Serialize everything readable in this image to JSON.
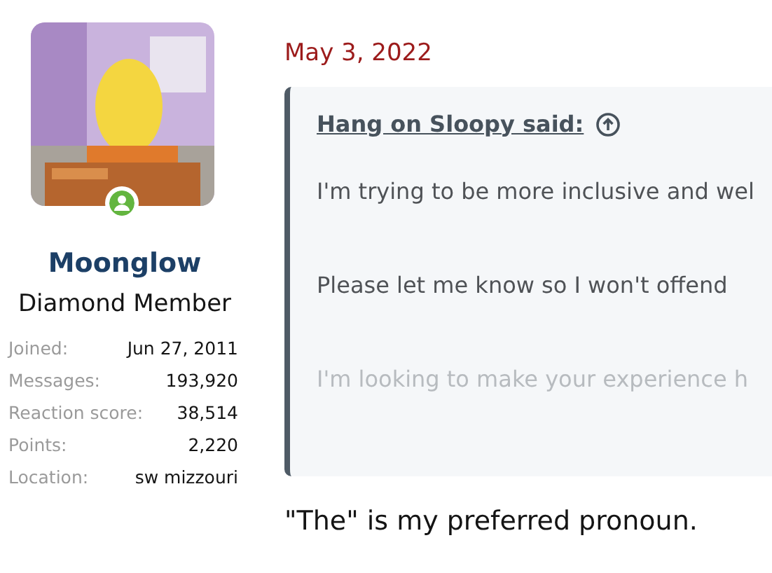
{
  "user": {
    "online": true,
    "name": "Moonglow",
    "title": "Diamond Member",
    "stats": [
      {
        "label": "Joined:",
        "value": "Jun 27, 2011"
      },
      {
        "label": "Messages:",
        "value": "193,920"
      },
      {
        "label": "Reaction score:",
        "value": "38,514"
      },
      {
        "label": "Points:",
        "value": "2,220"
      },
      {
        "label": "Location:",
        "value": "sw mizzouri"
      }
    ]
  },
  "post": {
    "date": "May 3, 2022",
    "quote": {
      "attribution": "Hang on Sloopy said:",
      "paragraphs": [
        {
          "text": "I'm trying to be more inclusive and wel",
          "faded": false
        },
        {
          "text": "Please let me know so I won't offend",
          "faded": false
        },
        {
          "text": "I'm looking to make your experience h",
          "faded": true
        }
      ]
    },
    "body": "\"The\" is my preferred pronoun."
  }
}
